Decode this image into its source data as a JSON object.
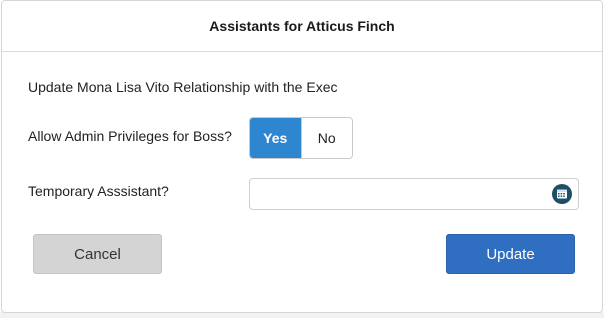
{
  "dialog": {
    "title": "Assistants for Atticus Finch",
    "heading": "Update Mona Lisa Vito Relationship with the Exec",
    "admin_privileges": {
      "label": "Allow Admin Privileges for Boss?",
      "yes_label": "Yes",
      "no_label": "No",
      "selected": "Yes"
    },
    "temporary_assistant": {
      "label": "Temporary Asssistant?",
      "value": "",
      "icon": "calendar-icon"
    },
    "buttons": {
      "cancel_label": "Cancel",
      "update_label": "Update"
    }
  },
  "colors": {
    "selected_toggle": "#2e86d0",
    "primary_button": "#2f6ec0",
    "secondary_button": "#d4d4d4",
    "calendar_icon": "#1f4f66"
  }
}
